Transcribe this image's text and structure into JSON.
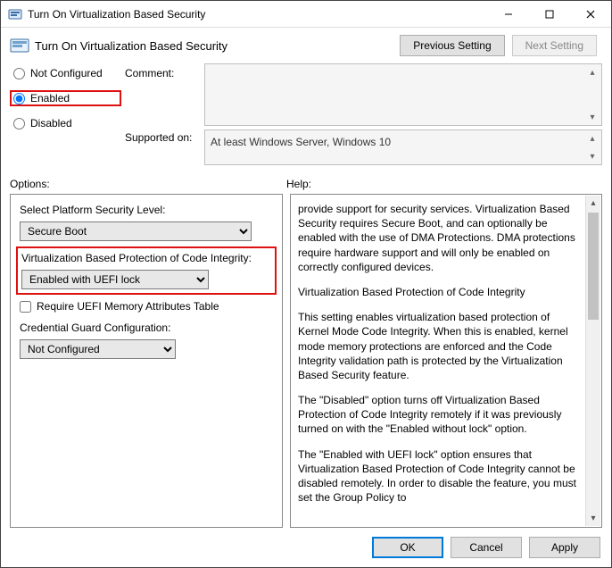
{
  "window": {
    "title": "Turn On Virtualization Based Security",
    "subtitle": "Turn On Virtualization Based Security"
  },
  "nav": {
    "prev": "Previous Setting",
    "next": "Next Setting"
  },
  "state": {
    "notconfigured_label": "Not Configured",
    "enabled_label": "Enabled",
    "disabled_label": "Disabled",
    "comment_label": "Comment:",
    "comment_value": "",
    "supported_label": "Supported on:",
    "supported_value": "At least Windows Server, Windows 10"
  },
  "sections": {
    "options_label": "Options:",
    "help_label": "Help:"
  },
  "options": {
    "platform_label": "Select Platform Security Level:",
    "platform_value": "Secure Boot",
    "vbs_label": "Virtualization Based Protection of Code Integrity:",
    "vbs_value": "Enabled with UEFI lock",
    "uefi_mem_label": "Require UEFI Memory Attributes Table",
    "credguard_label": "Credential Guard Configuration:",
    "credguard_value": "Not Configured"
  },
  "help": {
    "p1": "provide support for security services. Virtualization Based Security requires Secure Boot, and can optionally be enabled with the use of DMA Protections. DMA protections require hardware support and will only be enabled on correctly configured devices.",
    "p2": "Virtualization Based Protection of Code Integrity",
    "p3": "This setting enables virtualization based protection of Kernel Mode Code Integrity. When this is enabled, kernel mode memory protections are enforced and the Code Integrity validation path is protected by the Virtualization Based Security feature.",
    "p4": "The \"Disabled\" option turns off Virtualization Based Protection of Code Integrity remotely if it was previously turned on with the \"Enabled without lock\" option.",
    "p5": "The \"Enabled with UEFI lock\" option ensures that Virtualization Based Protection of Code Integrity cannot be disabled remotely. In order to disable the feature, you must set the Group Policy to"
  },
  "footer": {
    "ok": "OK",
    "cancel": "Cancel",
    "apply": "Apply"
  }
}
